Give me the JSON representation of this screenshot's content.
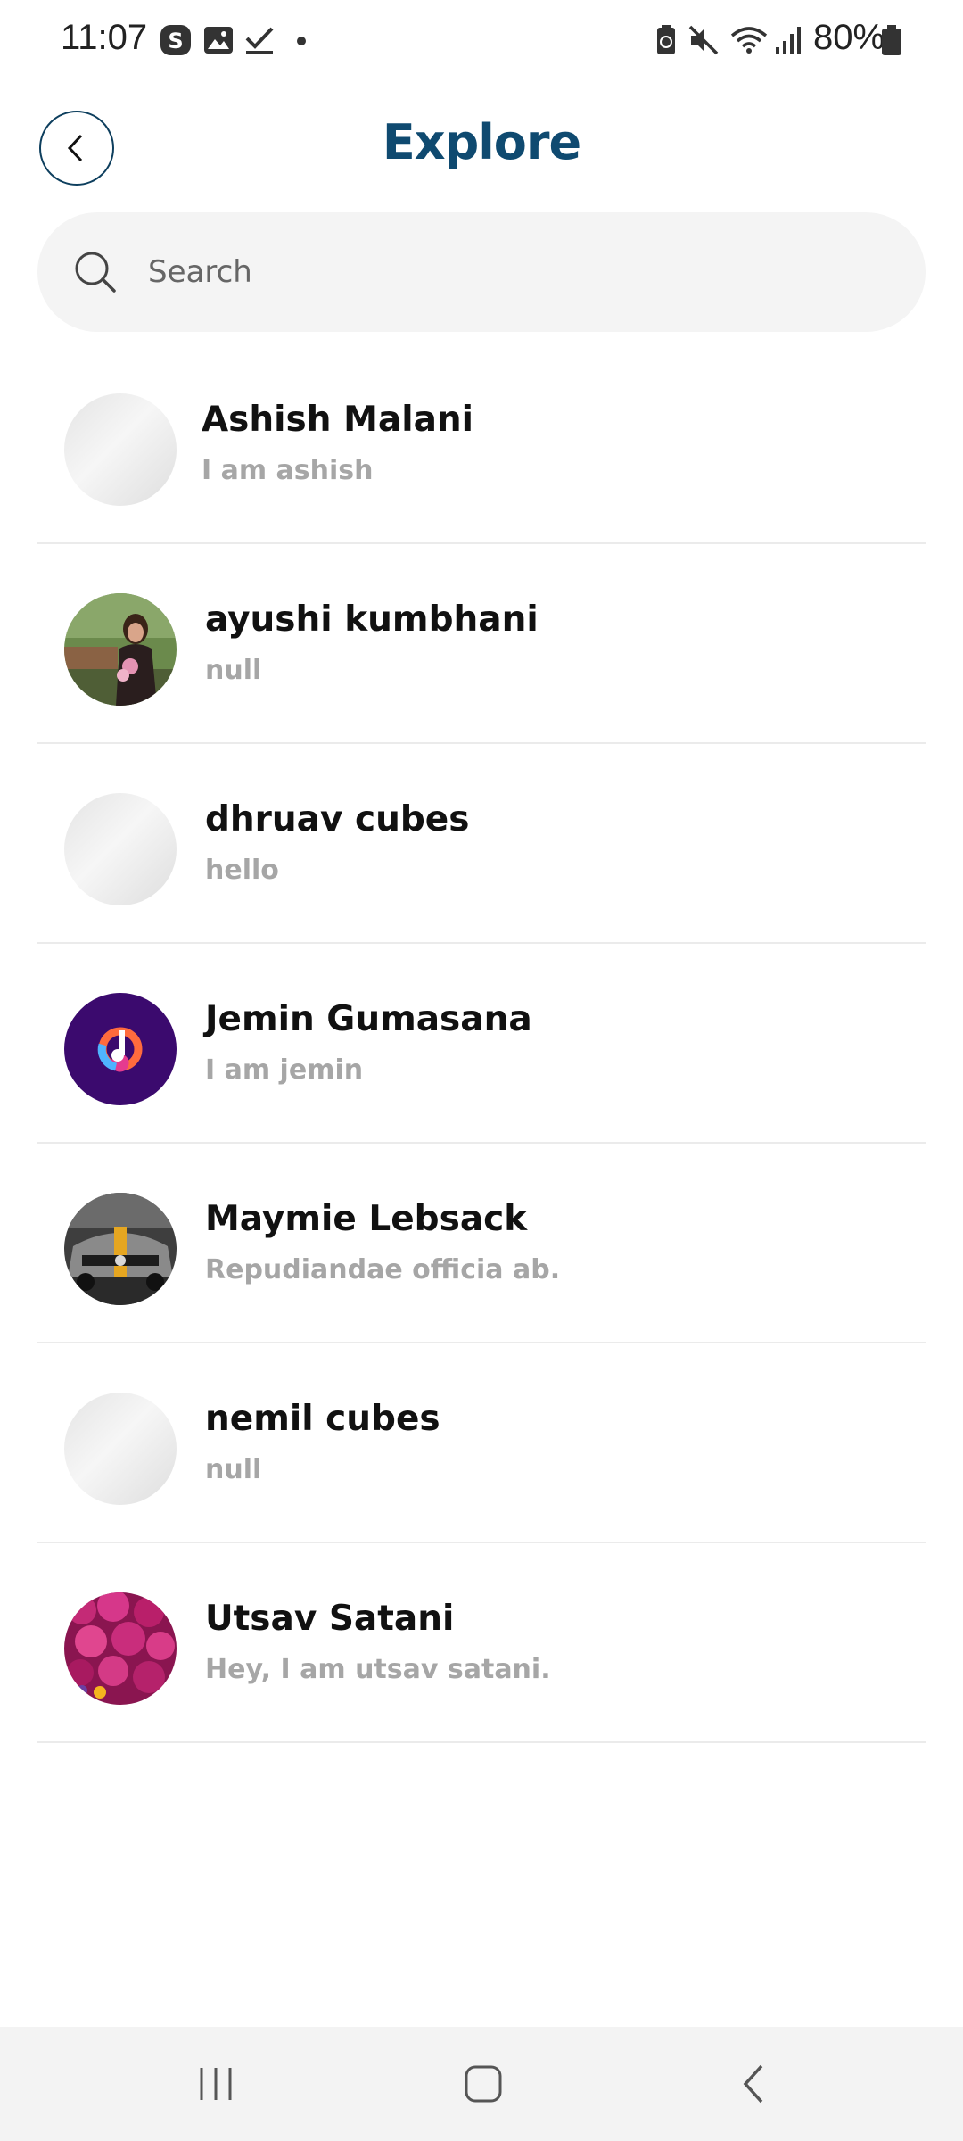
{
  "status_bar": {
    "time": "11:07",
    "battery": "80%",
    "icons": [
      "s-app-icon",
      "gallery-icon",
      "check-icon",
      "dot-icon",
      "battery-saver-icon",
      "mute-icon",
      "wifi-icon",
      "signal-icon",
      "battery-icon"
    ]
  },
  "header": {
    "title": "Explore",
    "back_icon": "chevron-left-icon"
  },
  "search": {
    "placeholder": "Search",
    "icon": "search-icon"
  },
  "users": [
    {
      "name": "Ashish Malani",
      "status": "I am ashish",
      "avatar": "placeholder"
    },
    {
      "name": "ayushi kumbhani",
      "status": "null",
      "avatar": "photo-girl-flowers"
    },
    {
      "name": "dhruav cubes",
      "status": "hello",
      "avatar": "placeholder"
    },
    {
      "name": "Jemin Gumasana",
      "status": "I am jemin",
      "avatar": "music-app-logo"
    },
    {
      "name": "Maymie Lebsack",
      "status": "Repudiandae officia ab.",
      "avatar": "photo-car"
    },
    {
      "name": "nemil cubes",
      "status": "null",
      "avatar": "placeholder"
    },
    {
      "name": "Utsav Satani",
      "status": "Hey, I am utsav satani.",
      "avatar": "photo-pink-flowers"
    }
  ],
  "nav_bar": {
    "buttons": [
      "recents-icon",
      "home-icon",
      "back-icon"
    ]
  },
  "colors": {
    "title": "#0f4a70",
    "back_border": "#0e3f5e",
    "search_bg": "#f4f4f4",
    "status_text": "#a6a6a6",
    "divider": "#ebebeb"
  }
}
